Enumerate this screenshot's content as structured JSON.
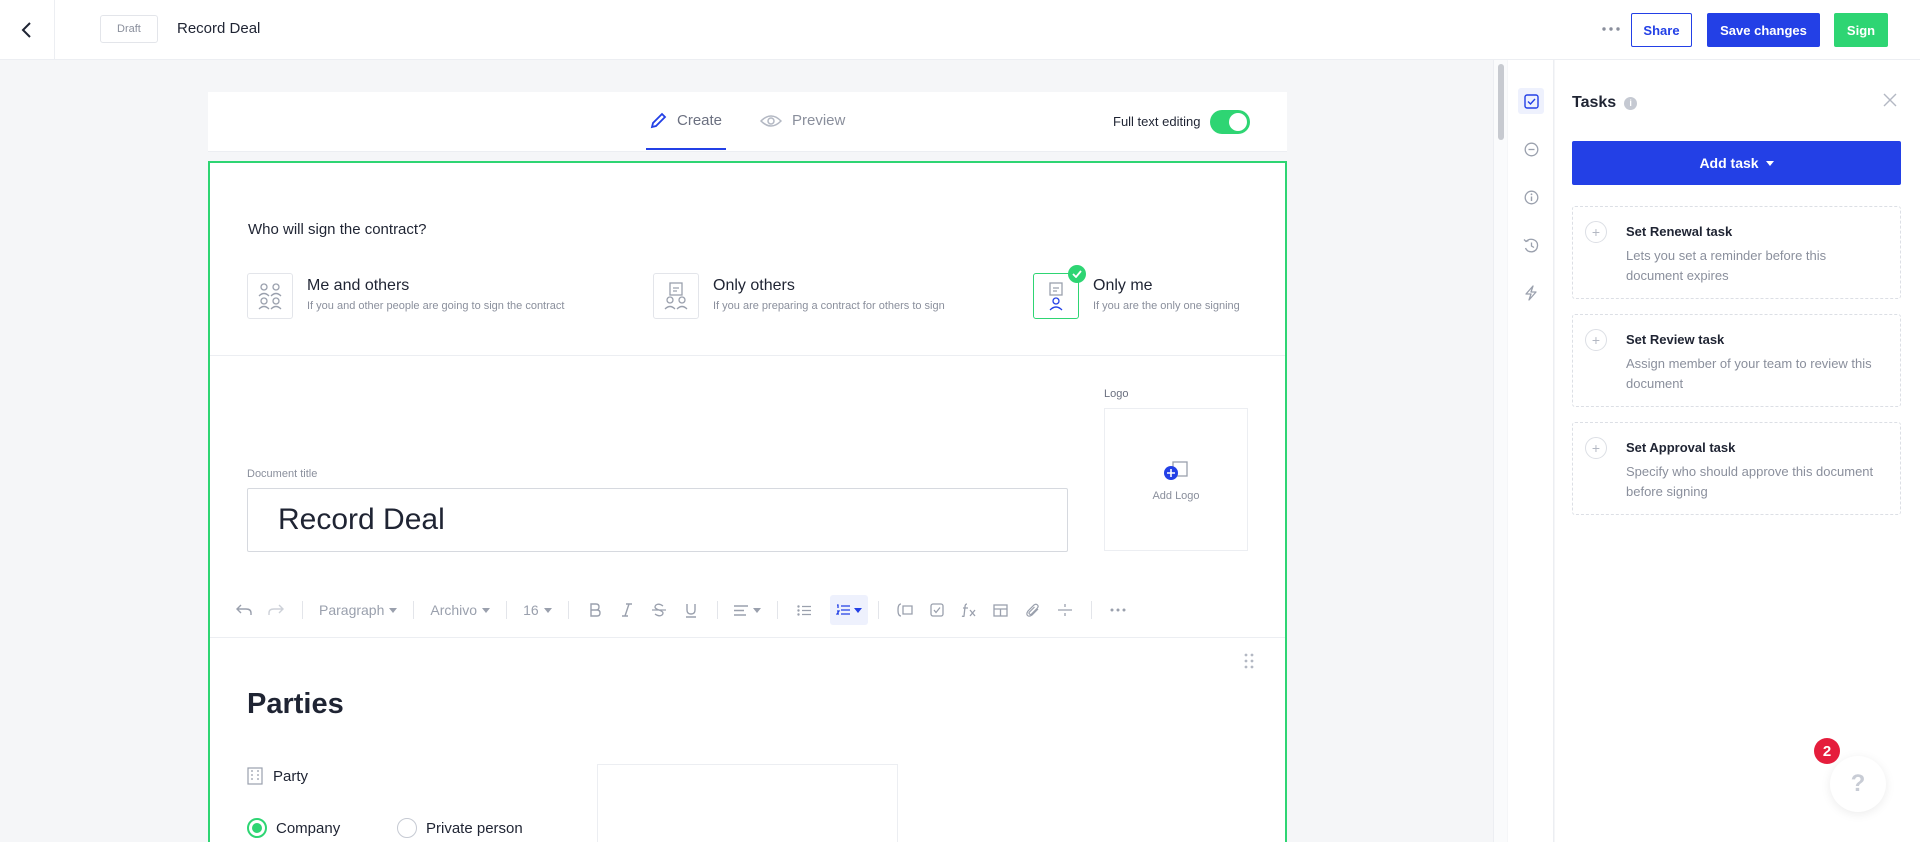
{
  "topbar": {
    "status_badge": "Draft",
    "doc_title": "Record Deal",
    "share_label": "Share",
    "save_label": "Save changes",
    "sign_label": "Sign"
  },
  "editor": {
    "tabs": [
      {
        "label": "Create",
        "icon": "pencil-icon",
        "active": true
      },
      {
        "label": "Preview",
        "icon": "eye-icon",
        "active": false
      }
    ],
    "full_text_editing_label": "Full text editing",
    "full_text_editing_on": true,
    "question": "Who will sign the contract?",
    "signer_options": [
      {
        "title": "Me and others",
        "subtitle": "If you and other people are going to sign the contract",
        "selected": false
      },
      {
        "title": "Only others",
        "subtitle": "If you are preparing a contract for others to sign",
        "selected": false
      },
      {
        "title": "Only me",
        "subtitle": "If you are the only one signing",
        "selected": true
      }
    ],
    "logo_label": "Logo",
    "add_logo_label": "Add Logo",
    "document_title_label": "Document title",
    "document_title_value": "Record Deal",
    "toolbar": {
      "block_style": "Paragraph",
      "font": "Archivo",
      "font_size": "16"
    },
    "parties_heading": "Parties",
    "party_label": "Party",
    "party_types": [
      {
        "label": "Company",
        "selected": true
      },
      {
        "label": "Private person",
        "selected": false
      }
    ]
  },
  "tasks_panel": {
    "title": "Tasks",
    "add_task_label": "Add task",
    "cards": [
      {
        "title": "Set Renewal task",
        "description": "Lets you set a reminder before this document expires"
      },
      {
        "title": "Set Review task",
        "description": "Assign member of your team to review this document"
      },
      {
        "title": "Set Approval task",
        "description": "Specify who should approve this document before signing"
      }
    ]
  },
  "help": {
    "badge_count": "2",
    "icon_text": "?"
  },
  "colors": {
    "brand_blue": "#2340e6",
    "accent_green": "#2ed573",
    "badge_red": "#e51d3c"
  }
}
